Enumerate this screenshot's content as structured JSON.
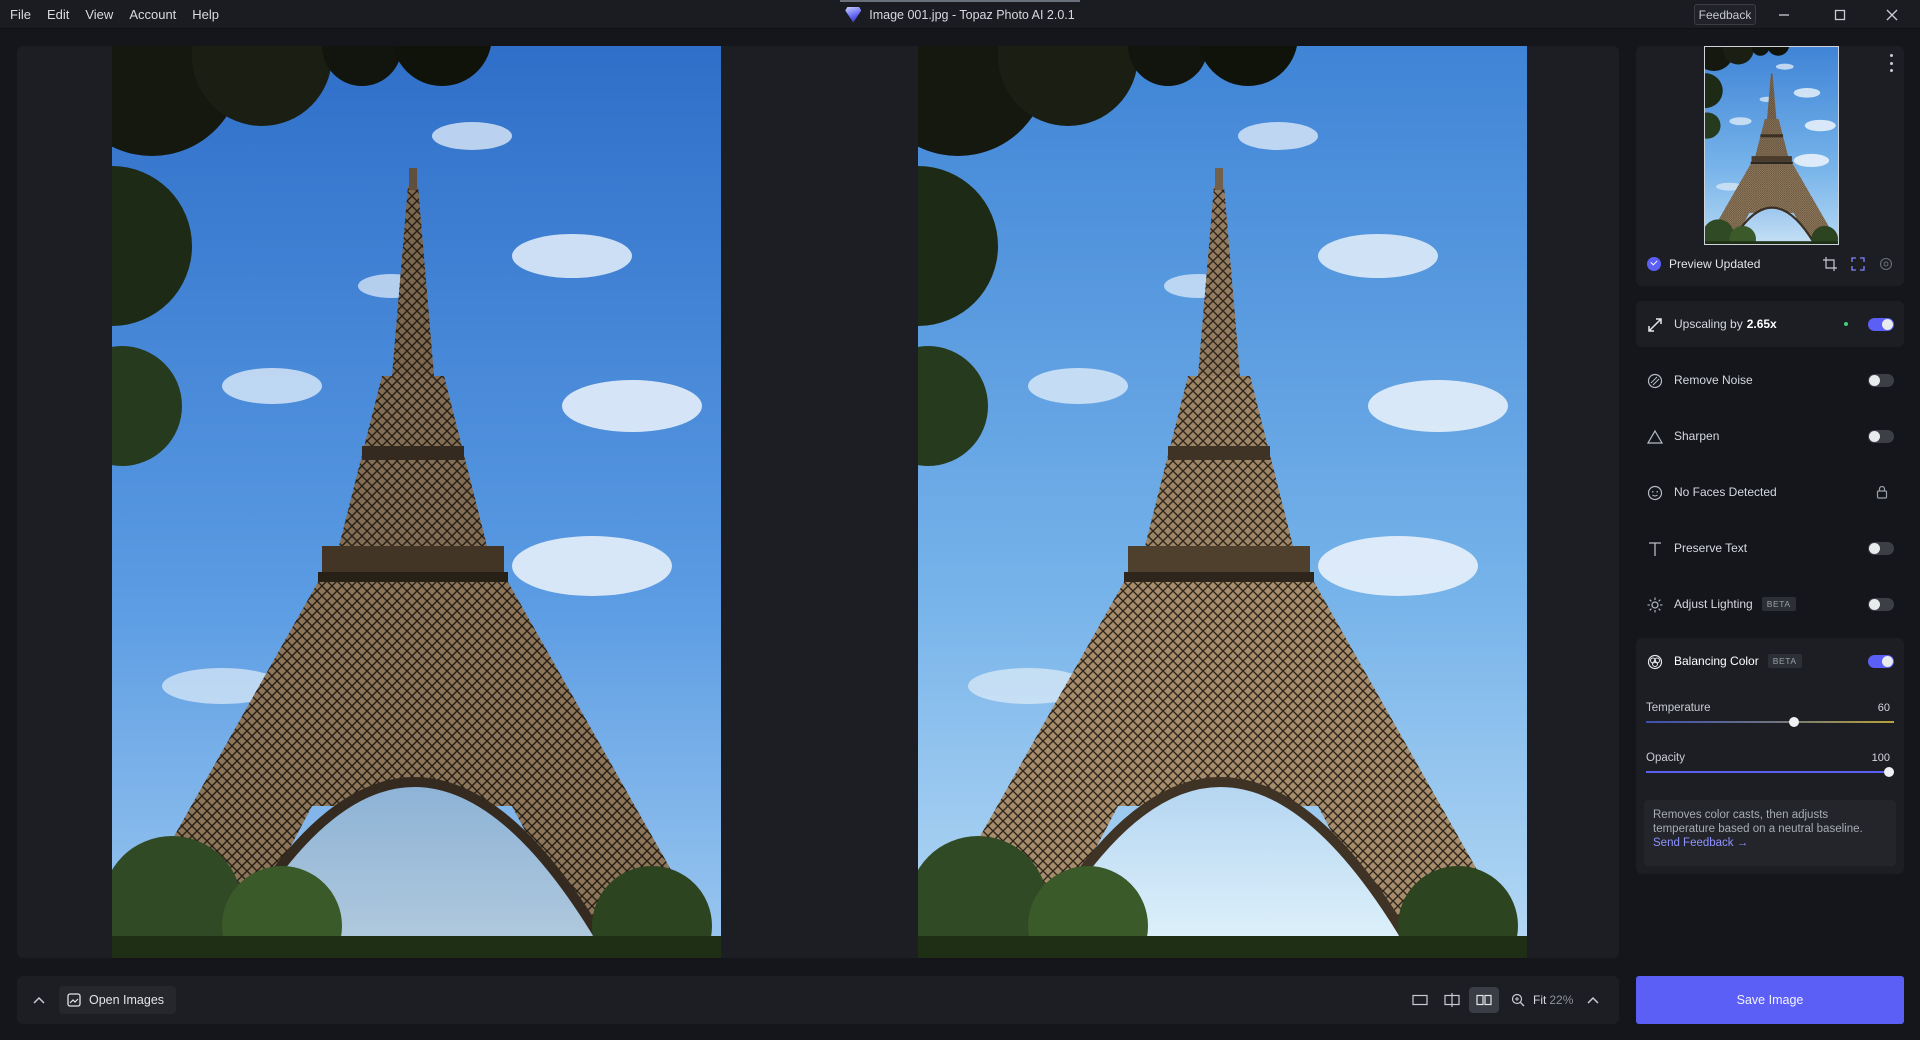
{
  "menu": [
    "File",
    "Edit",
    "View",
    "Account",
    "Help"
  ],
  "window": {
    "title": "Image 001.jpg - Topaz Photo AI 2.0.1",
    "feedback_label": "Feedback"
  },
  "preview": {
    "status": "Preview Updated"
  },
  "filters": {
    "upscale": {
      "label": "Upscaling by",
      "value": "2.65x",
      "enabled": true
    },
    "noise": {
      "label": "Remove Noise",
      "enabled": false
    },
    "sharpen": {
      "label": "Sharpen",
      "enabled": false
    },
    "faces": {
      "label": "No Faces Detected",
      "locked": true
    },
    "text": {
      "label": "Preserve Text",
      "enabled": false
    },
    "lighting": {
      "label": "Adjust Lighting",
      "badge": "BETA",
      "enabled": false
    },
    "color": {
      "label": "Balancing Color",
      "badge": "BETA",
      "enabled": true,
      "temperature": {
        "label": "Temperature",
        "value": "60",
        "fraction": 0.6
      },
      "opacity": {
        "label": "Opacity",
        "value": "100",
        "fraction": 1.0
      },
      "info": "Removes color casts, then adjusts temperature based on a neutral baseline.",
      "link": "Send Feedback →"
    }
  },
  "bottom": {
    "open_images": "Open Images",
    "zoom_label": "Fit",
    "zoom_value": "22%"
  },
  "save_label": "Save Image",
  "colors": {
    "accent": "#5b5ff5",
    "status_dot": "#3fd17a"
  }
}
